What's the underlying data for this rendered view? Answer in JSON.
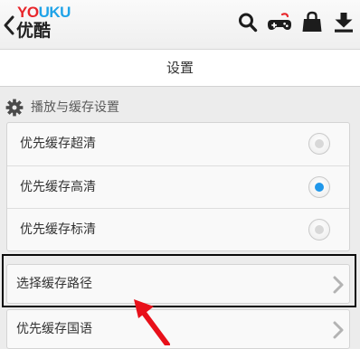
{
  "header": {
    "logo_latin_a": "YO",
    "logo_latin_b": "UKU",
    "logo_chinese": "优酷",
    "back_icon": "chevron-left-icon",
    "action_icons": [
      "search-icon",
      "gamepad-icon",
      "shopping-bag-icon",
      "download-icon"
    ]
  },
  "page": {
    "title": "设置"
  },
  "section": {
    "title": "播放与缓存设置",
    "icon": "gear-icon"
  },
  "cache_quality": {
    "options": [
      {
        "label": "优先缓存超清",
        "selected": false
      },
      {
        "label": "优先缓存高清",
        "selected": true
      },
      {
        "label": "优先缓存标清",
        "selected": false
      }
    ]
  },
  "nav_items": [
    {
      "label": "选择缓存路径",
      "highlighted": true
    },
    {
      "label": "优先缓存国语",
      "highlighted": false
    }
  ],
  "colors": {
    "brand_red": "#e8262b",
    "brand_blue": "#1fa3e8",
    "radio_selected": "#1f97ea",
    "annotation_red": "#e8101a",
    "highlight_border": "#0a0a0a"
  }
}
